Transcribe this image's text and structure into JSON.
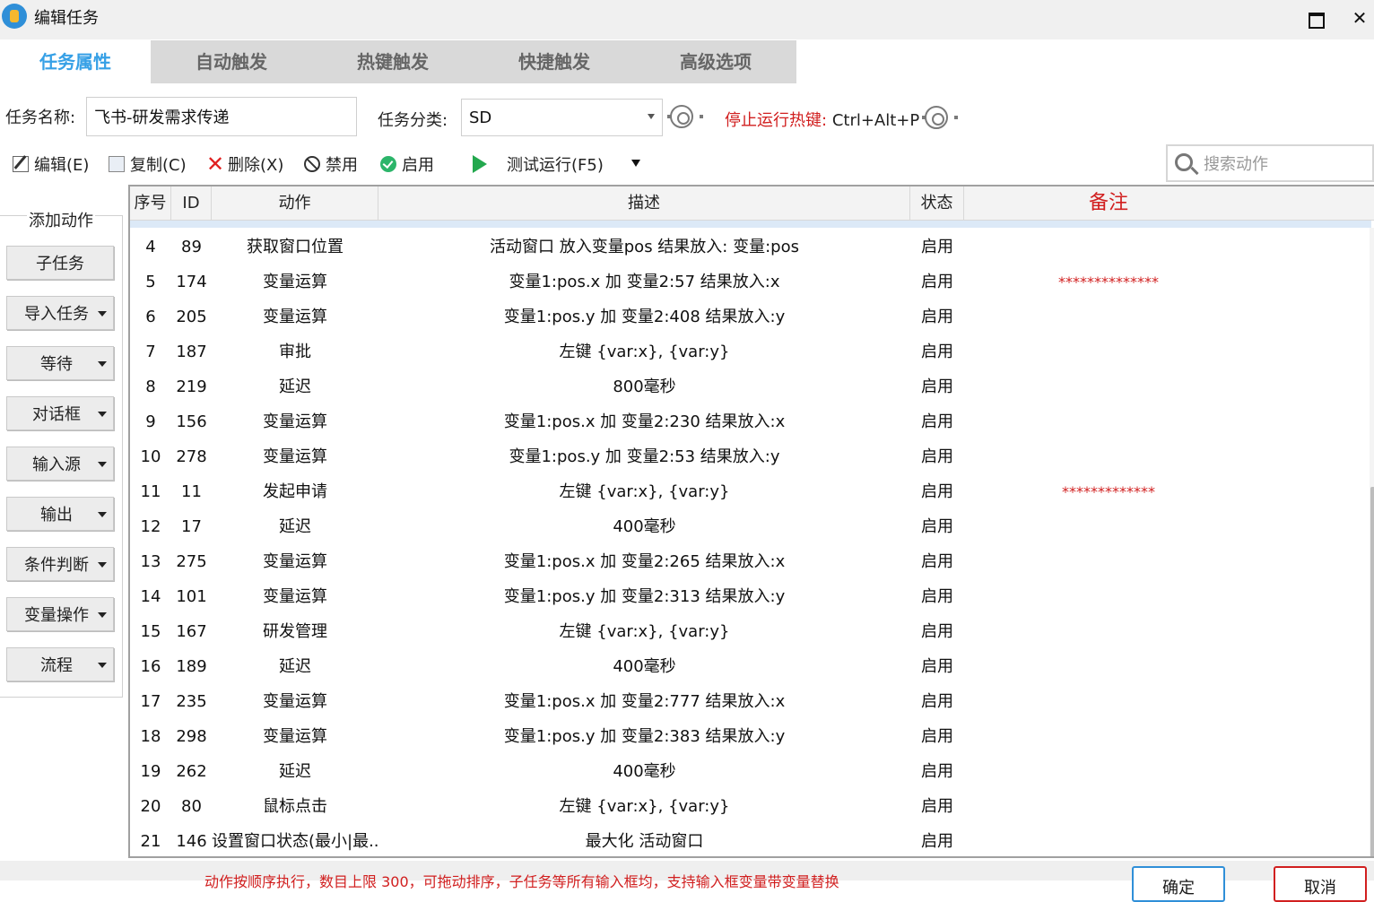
{
  "window": {
    "title": "编辑任务"
  },
  "tabs": [
    {
      "label": "任务属性",
      "active": true
    },
    {
      "label": "自动触发",
      "active": false
    },
    {
      "label": "热键触发",
      "active": false
    },
    {
      "label": "快捷触发",
      "active": false
    },
    {
      "label": "高级选项",
      "active": false
    }
  ],
  "form": {
    "name_label": "任务名称:",
    "name_value": "飞书-研发需求传递",
    "category_label": "任务分类:",
    "category_value": "SD",
    "hotkey_label": "停止运行热键:",
    "hotkey_value": "Ctrl+Alt+P"
  },
  "toolbar": {
    "edit": "编辑(E)",
    "copy": "复制(C)",
    "delete": "删除(X)",
    "disable": "禁用",
    "enable": "启用",
    "test_run": "测试运行(F5)",
    "search_placeholder": "搜索动作"
  },
  "left_panel": {
    "title": "添加动作",
    "buttons": [
      {
        "label": "子任务",
        "dropdown": false
      },
      {
        "label": "导入任务",
        "dropdown": true
      },
      {
        "label": "等待",
        "dropdown": true
      },
      {
        "label": "对话框",
        "dropdown": true
      },
      {
        "label": "输入源",
        "dropdown": true
      },
      {
        "label": "输出",
        "dropdown": true
      },
      {
        "label": "条件判断",
        "dropdown": true
      },
      {
        "label": "变量操作",
        "dropdown": true
      },
      {
        "label": "流程",
        "dropdown": true
      }
    ]
  },
  "table": {
    "headers": {
      "seq": "序号",
      "id": "ID",
      "action": "动作",
      "desc": "描述",
      "status": "状态",
      "remark": "备注"
    },
    "rows": [
      {
        "seq": "4",
        "id": "89",
        "action": "获取窗口位置",
        "desc": "活动窗口 放入变量pos 结果放入: 变量:pos",
        "status": "启用",
        "remark": ""
      },
      {
        "seq": "5",
        "id": "174",
        "action": "变量运算",
        "desc": "变量1:pos.x 加 变量2:57 结果放入:x",
        "status": "启用",
        "remark": "**************"
      },
      {
        "seq": "6",
        "id": "205",
        "action": "变量运算",
        "desc": "变量1:pos.y 加 变量2:408 结果放入:y",
        "status": "启用",
        "remark": ""
      },
      {
        "seq": "7",
        "id": "187",
        "action": "审批",
        "desc": "左键 {var:x}, {var:y}",
        "status": "启用",
        "remark": ""
      },
      {
        "seq": "8",
        "id": "219",
        "action": "延迟",
        "desc": "800毫秒",
        "status": "启用",
        "remark": ""
      },
      {
        "seq": "9",
        "id": "156",
        "action": "变量运算",
        "desc": "变量1:pos.x 加 变量2:230 结果放入:x",
        "status": "启用",
        "remark": ""
      },
      {
        "seq": "10",
        "id": "278",
        "action": "变量运算",
        "desc": "变量1:pos.y 加 变量2:53 结果放入:y",
        "status": "启用",
        "remark": ""
      },
      {
        "seq": "11",
        "id": "11",
        "action": "发起申请",
        "desc": "左键 {var:x}, {var:y}",
        "status": "启用",
        "remark": "*************"
      },
      {
        "seq": "12",
        "id": "17",
        "action": "延迟",
        "desc": "400毫秒",
        "status": "启用",
        "remark": ""
      },
      {
        "seq": "13",
        "id": "275",
        "action": "变量运算",
        "desc": "变量1:pos.x 加 变量2:265 结果放入:x",
        "status": "启用",
        "remark": ""
      },
      {
        "seq": "14",
        "id": "101",
        "action": "变量运算",
        "desc": "变量1:pos.y 加 变量2:313 结果放入:y",
        "status": "启用",
        "remark": ""
      },
      {
        "seq": "15",
        "id": "167",
        "action": "研发管理",
        "desc": "左键 {var:x}, {var:y}",
        "status": "启用",
        "remark": ""
      },
      {
        "seq": "16",
        "id": "189",
        "action": "延迟",
        "desc": "400毫秒",
        "status": "启用",
        "remark": ""
      },
      {
        "seq": "17",
        "id": "235",
        "action": "变量运算",
        "desc": "变量1:pos.x 加 变量2:777 结果放入:x",
        "status": "启用",
        "remark": ""
      },
      {
        "seq": "18",
        "id": "298",
        "action": "变量运算",
        "desc": "变量1:pos.y 加 变量2:383 结果放入:y",
        "status": "启用",
        "remark": ""
      },
      {
        "seq": "19",
        "id": "262",
        "action": "延迟",
        "desc": "400毫秒",
        "status": "启用",
        "remark": ""
      },
      {
        "seq": "20",
        "id": "80",
        "action": "鼠标点击",
        "desc": "左键 {var:x}, {var:y}",
        "status": "启用",
        "remark": ""
      },
      {
        "seq": "21",
        "id": "146",
        "action": "设置窗口状态(最小|最...",
        "desc": "最大化 活动窗口",
        "status": "启用",
        "remark": ""
      }
    ]
  },
  "footer": {
    "message": "动作按顺序执行，数目上限 300，可拖动排序，子任务等所有输入框均，支持输入框变量带变量替换",
    "ok": "确定",
    "cancel": "取消"
  },
  "colors": {
    "accent": "#36a0e6",
    "danger": "#d11f1f",
    "ok_border": "#2f8fd8",
    "enable_green": "#2cb56a"
  }
}
